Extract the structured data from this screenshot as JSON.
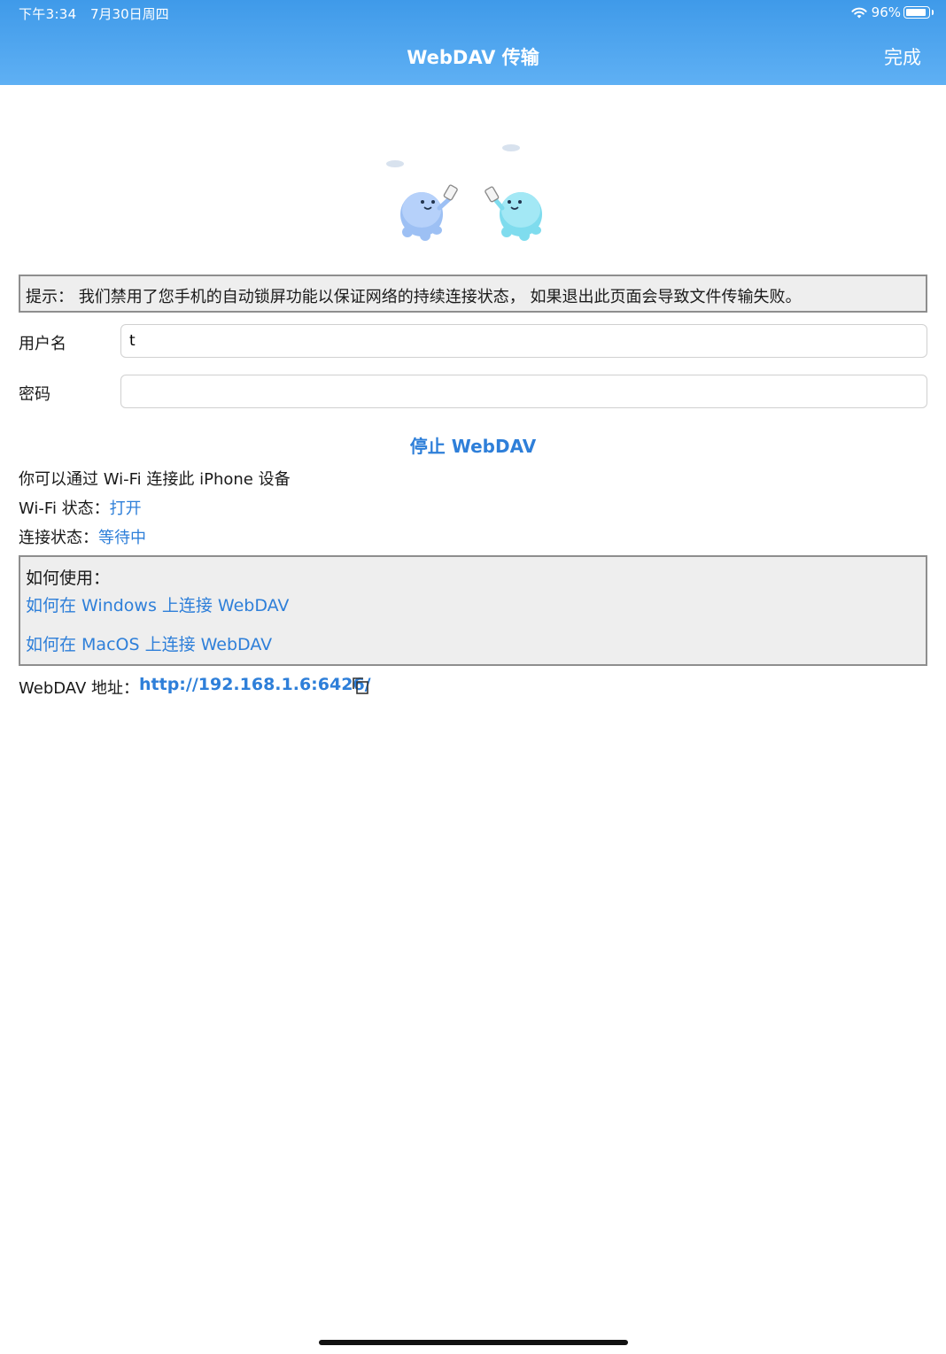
{
  "status_bar": {
    "time": "下午3:34",
    "date": "7月30日周四",
    "battery": "96%",
    "icons": [
      "wifi-icon",
      "battery-icon"
    ]
  },
  "nav": {
    "title": "WebDAV 传输",
    "done_label": "完成"
  },
  "tip": {
    "text": "提示：  我们禁用了您手机的自动锁屏功能以保证网络的持续连接状态，  如果退出此页面会导致文件传输失败。"
  },
  "form": {
    "username_label": "用户名",
    "username_value": "t",
    "password_label": "密码",
    "password_value": ""
  },
  "stop_button_label": "停止 WebDAV",
  "info": {
    "connect_hint": "你可以通过 Wi-Fi 连接此 iPhone 设备",
    "wifi_label": "Wi-Fi 状态：",
    "wifi_value": "打开",
    "conn_label": "连接状态：",
    "conn_value": "等待中"
  },
  "howto": {
    "title": "如何使用：",
    "links": [
      "如何在 Windows 上连接 WebDAV",
      "如何在 MacOS 上连接 WebDAV"
    ]
  },
  "address": {
    "label": "WebDAV 地址：",
    "url": "http://192.168.1.6:6426/"
  },
  "colors": {
    "header": "#4aa3ee",
    "accent": "#2e7fd9",
    "box_bg": "#eeeeee",
    "box_border": "#8e8e8e"
  }
}
